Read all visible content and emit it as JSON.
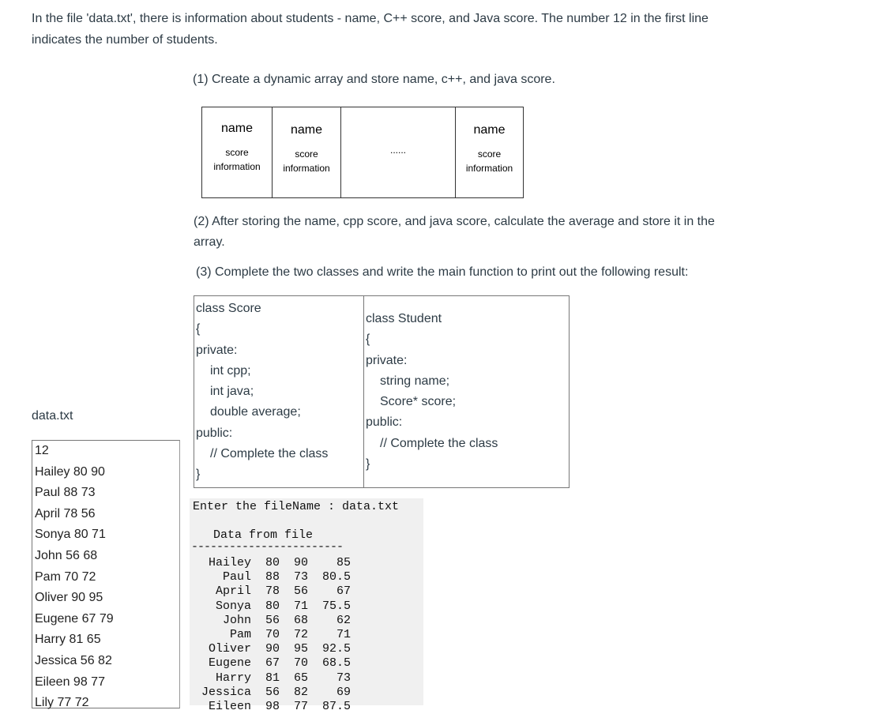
{
  "intro": "In the file 'data.txt', there is information about students - name, C++ score, and Java score. The number 12 in the first line indicates the number of students.",
  "q1": "(1) Create a dynamic array and store name, c++, and java score.",
  "array_diagram": {
    "cells": [
      {
        "name": "name",
        "score": "score",
        "info": "information"
      },
      {
        "name": "name",
        "score": "score",
        "info": "information"
      },
      {
        "ellipsis": "......"
      },
      {
        "name": "name",
        "score": "score",
        "info": "information"
      }
    ]
  },
  "q2": "(2) After storing the name, cpp score, and java score, calculate the average and store it in the array.",
  "q3": "(3) Complete the two classes and write the main function to print out the following result:",
  "class_score": [
    "class Score",
    "{",
    "private:",
    "int cpp;",
    "int java;",
    "double average;",
    "public:",
    "// Complete the class",
    "}"
  ],
  "class_student": [
    "class Student",
    "{",
    "private:",
    "string name;",
    "Score* score;",
    "public:",
    "// Complete the class",
    "}"
  ],
  "datafile": {
    "label": "data.txt",
    "lines": [
      "12",
      "Hailey 80 90",
      "Paul 88 73",
      "April 78 56",
      "Sonya 80 71",
      "John 56 68",
      "Pam 70 72",
      "Oliver 90 95",
      "Eugene 67 79",
      "Harry 81 65",
      "Jessica 56 82",
      "Eileen 98 77",
      "Lily 77 72"
    ]
  },
  "console": {
    "prompt": "Enter the fileName : data.txt",
    "header": "Data from file",
    "separator": "------------------------",
    "rows": [
      {
        "name": "Hailey",
        "cpp": "80",
        "java": "90",
        "avg": "85"
      },
      {
        "name": "Paul",
        "cpp": "88",
        "java": "73",
        "avg": "80.5"
      },
      {
        "name": "April",
        "cpp": "78",
        "java": "56",
        "avg": "67"
      },
      {
        "name": "Sonya",
        "cpp": "80",
        "java": "71",
        "avg": "75.5"
      },
      {
        "name": "John",
        "cpp": "56",
        "java": "68",
        "avg": "62"
      },
      {
        "name": "Pam",
        "cpp": "70",
        "java": "72",
        "avg": "71"
      },
      {
        "name": "Oliver",
        "cpp": "90",
        "java": "95",
        "avg": "92.5"
      },
      {
        "name": "Eugene",
        "cpp": "67",
        "java": "70",
        "avg": "68.5"
      },
      {
        "name": "Harry",
        "cpp": "81",
        "java": "65",
        "avg": "73"
      },
      {
        "name": "Jessica",
        "cpp": "56",
        "java": "82",
        "avg": "69"
      },
      {
        "name": "Eileen",
        "cpp": "98",
        "java": "77",
        "avg": "87.5"
      }
    ]
  }
}
